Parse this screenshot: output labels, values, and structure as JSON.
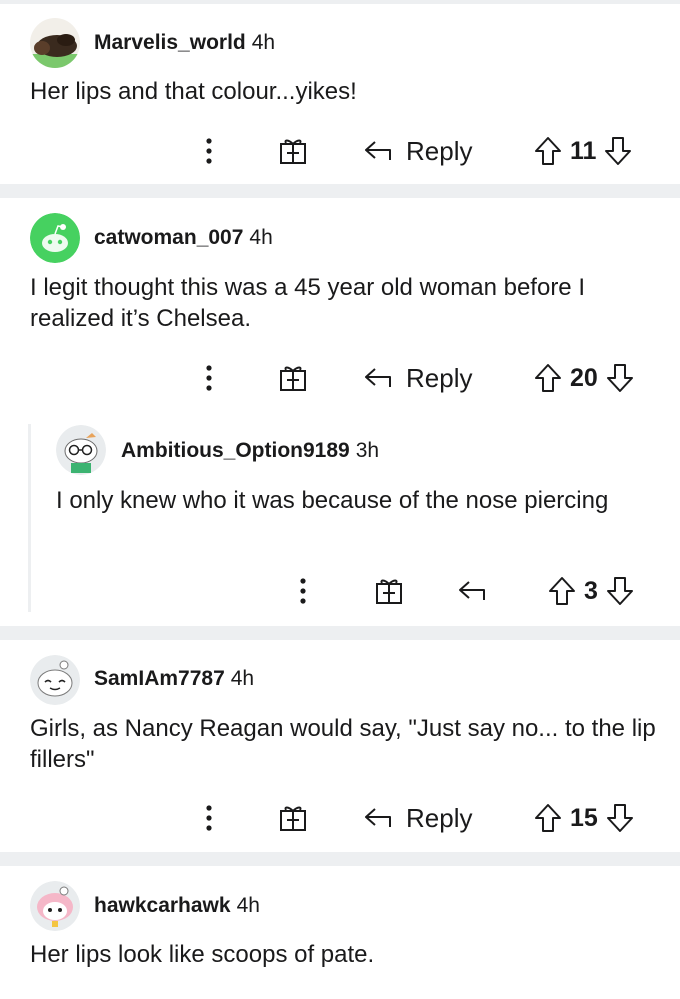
{
  "comments": [
    {
      "user": "Marvelis_world",
      "time": "4h",
      "text": "Her lips and that colour...yikes!",
      "reply_label": "Reply",
      "votes": "11",
      "avatar": "dog-avatar"
    },
    {
      "user": "catwoman_007",
      "time": "4h",
      "text": "I legit thought this was a 45 year old woman before I realized it’s Chelsea.",
      "reply_label": "Reply",
      "votes": "20",
      "avatar": "snoo-green-avatar"
    },
    {
      "user": "Ambitious_Option9189",
      "time": "3h",
      "text": "I only knew who it was because of the nose piercing",
      "votes": "3",
      "avatar": "snoo-glasses-avatar"
    },
    {
      "user": "SamIAm7787",
      "time": "4h",
      "text": "Girls, as Nancy Reagan would say, \"Just say no... to the lip fillers\"",
      "reply_label": "Reply",
      "votes": "15",
      "avatar": "snoo-white-avatar"
    },
    {
      "user": "hawkcarhawk",
      "time": "4h",
      "text": "Her lips look like scoops of pate.",
      "avatar": "snoo-pink-avatar"
    }
  ],
  "colors": {
    "separator": "#edeff1",
    "text": "#1a1a1b",
    "icon": "#1a1a1b",
    "snoo_green": "#46d160"
  }
}
